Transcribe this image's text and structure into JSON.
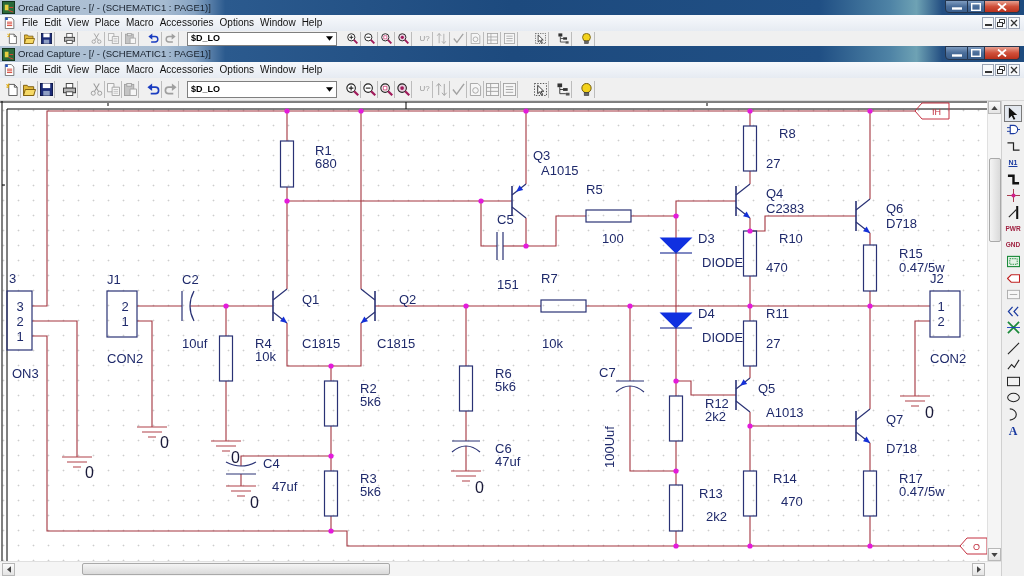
{
  "windows": [
    {
      "title": "Orcad Capture - [/ - (SCHEMATIC1 : PAGE1)]",
      "menu": [
        "File",
        "Edit",
        "View",
        "Place",
        "Macro",
        "Accessories",
        "Options",
        "Window",
        "Help"
      ],
      "toolbar": [
        {
          "kind": "new",
          "disabled": false
        },
        {
          "kind": "open",
          "disabled": false
        },
        {
          "kind": "save",
          "disabled": false
        },
        {
          "kind": "print",
          "disabled": false
        },
        {
          "kind": "cut",
          "disabled": true
        },
        {
          "kind": "copy",
          "disabled": true
        },
        {
          "kind": "paste",
          "disabled": true
        },
        {
          "kind": "undo",
          "disabled": false
        },
        {
          "kind": "redo",
          "disabled": true
        },
        {
          "kind": "part_combo",
          "value": "$D_LO",
          "disabled": false
        },
        {
          "kind": "zoom_in",
          "disabled": false
        },
        {
          "kind": "zoom_out",
          "disabled": false
        },
        {
          "kind": "zoom_area",
          "disabled": false
        },
        {
          "kind": "zoom_all",
          "disabled": false
        },
        {
          "kind": "annotate",
          "glyph": "U?",
          "disabled": true
        },
        {
          "kind": "back_annotate",
          "disabled": true
        },
        {
          "kind": "drc",
          "disabled": true
        },
        {
          "kind": "netlist",
          "disabled": true
        },
        {
          "kind": "cross_ref",
          "disabled": true
        },
        {
          "kind": "bom",
          "disabled": true
        },
        {
          "kind": "area_select",
          "disabled": false
        },
        {
          "kind": "tree",
          "disabled": false
        },
        {
          "kind": "help",
          "disabled": false
        }
      ]
    },
    {
      "title": "Orcad Capture - [/ - (SCHEMATIC1 : PAGE1)]",
      "menu": [
        "File",
        "Edit",
        "View",
        "Place",
        "Macro",
        "Accessories",
        "Options",
        "Window",
        "Help"
      ],
      "toolbar": [
        {
          "kind": "new",
          "disabled": false
        },
        {
          "kind": "open",
          "disabled": false
        },
        {
          "kind": "save",
          "disabled": false
        },
        {
          "kind": "print",
          "disabled": false
        },
        {
          "kind": "cut",
          "disabled": true
        },
        {
          "kind": "copy",
          "disabled": true
        },
        {
          "kind": "paste",
          "disabled": true
        },
        {
          "kind": "undo",
          "disabled": false
        },
        {
          "kind": "redo",
          "disabled": true
        },
        {
          "kind": "part_combo",
          "value": "$D_LO",
          "disabled": false
        },
        {
          "kind": "zoom_in",
          "disabled": false
        },
        {
          "kind": "zoom_out",
          "disabled": false
        },
        {
          "kind": "zoom_area",
          "disabled": false
        },
        {
          "kind": "zoom_all",
          "disabled": false
        },
        {
          "kind": "annotate",
          "glyph": "U?",
          "disabled": true
        },
        {
          "kind": "back_annotate",
          "disabled": true
        },
        {
          "kind": "drc",
          "disabled": true
        },
        {
          "kind": "netlist",
          "disabled": true
        },
        {
          "kind": "cross_ref",
          "disabled": true
        },
        {
          "kind": "bom",
          "disabled": true
        },
        {
          "kind": "area_select",
          "disabled": false
        },
        {
          "kind": "tree",
          "disabled": false
        },
        {
          "kind": "help",
          "disabled": false
        }
      ],
      "palette": [
        {
          "kind": "select",
          "selected": true,
          "disabled": false
        },
        {
          "kind": "part",
          "selected": false,
          "disabled": false
        },
        {
          "kind": "wire",
          "selected": false,
          "disabled": false
        },
        {
          "kind": "net_alias",
          "glyph": "N1",
          "selected": false,
          "disabled": false
        },
        {
          "kind": "bus",
          "selected": false,
          "disabled": false
        },
        {
          "kind": "junction",
          "selected": false,
          "disabled": false
        },
        {
          "kind": "bus_entry",
          "selected": false,
          "disabled": false
        },
        {
          "kind": "power",
          "glyph": "PWR",
          "selected": false,
          "disabled": false
        },
        {
          "kind": "ground",
          "glyph": "GND",
          "selected": false,
          "disabled": false
        },
        {
          "kind": "hier_block",
          "selected": false,
          "disabled": false
        },
        {
          "kind": "hier_port",
          "selected": false,
          "disabled": false
        },
        {
          "kind": "hier_pin",
          "selected": false,
          "disabled": true
        },
        {
          "kind": "off_page",
          "selected": false,
          "disabled": false
        },
        {
          "kind": "no_connect",
          "selected": false,
          "disabled": false
        },
        {
          "kind": "line",
          "selected": false,
          "disabled": false
        },
        {
          "kind": "polyline",
          "selected": false,
          "disabled": false
        },
        {
          "kind": "rectangle",
          "selected": false,
          "disabled": false
        },
        {
          "kind": "ellipse",
          "selected": false,
          "disabled": false
        },
        {
          "kind": "arc",
          "selected": false,
          "disabled": false
        },
        {
          "kind": "text",
          "glyph": "A",
          "selected": false,
          "disabled": false
        }
      ],
      "schematic": {
        "parts": [
          {
            "kind": "connector",
            "ref": "3",
            "value": "ON3",
            "pins": [
              "3",
              "2",
              "1"
            ]
          },
          {
            "kind": "connector",
            "ref": "J1",
            "value": "CON2",
            "pins": [
              "2",
              "1"
            ]
          },
          {
            "kind": "polarized_capacitor",
            "ref": "C2",
            "value": "10uf"
          },
          {
            "kind": "resistor",
            "ref": "R4",
            "value": "10k"
          },
          {
            "kind": "polarized_capacitor",
            "ref": "C4",
            "value": "47uf"
          },
          {
            "kind": "resistor",
            "ref": "R1",
            "value": "680"
          },
          {
            "kind": "npn",
            "ref": "Q1",
            "value": "C1815"
          },
          {
            "kind": "npn",
            "ref": "Q2",
            "value": "C1815"
          },
          {
            "kind": "resistor",
            "ref": "R2",
            "value": "5k6"
          },
          {
            "kind": "resistor",
            "ref": "R3",
            "value": "5k6"
          },
          {
            "kind": "capacitor",
            "ref": "C5",
            "value": "151"
          },
          {
            "kind": "resistor",
            "ref": "R6",
            "value": "5k6"
          },
          {
            "kind": "polarized_capacitor",
            "ref": "C6",
            "value": "47uf"
          },
          {
            "kind": "pnp",
            "ref": "Q3",
            "value": "A1015"
          },
          {
            "kind": "resistor",
            "ref": "R7",
            "value": "10k"
          },
          {
            "kind": "resistor",
            "ref": "R5",
            "value": "100"
          },
          {
            "kind": "polarized_capacitor",
            "ref": "C7",
            "value": "100Uuf"
          },
          {
            "kind": "diode",
            "ref": "D3",
            "value": "DIODE"
          },
          {
            "kind": "diode",
            "ref": "D4",
            "value": "DIODE"
          },
          {
            "kind": "resistor",
            "ref": "R12",
            "value": "2k2"
          },
          {
            "kind": "resistor",
            "ref": "R13",
            "value": "2k2"
          },
          {
            "kind": "resistor",
            "ref": "R8",
            "value": "27"
          },
          {
            "kind": "npn",
            "ref": "Q4",
            "value": "C2383"
          },
          {
            "kind": "resistor",
            "ref": "R10",
            "value": "470"
          },
          {
            "kind": "resistor",
            "ref": "R11",
            "value": "27"
          },
          {
            "kind": "pnp",
            "ref": "Q5",
            "value": "A1013"
          },
          {
            "kind": "resistor",
            "ref": "R14",
            "value": "470"
          },
          {
            "kind": "npn",
            "ref": "Q6",
            "value": "D718"
          },
          {
            "kind": "resistor",
            "ref": "R15",
            "value": "0.47/5w"
          },
          {
            "kind": "connector",
            "ref": "J2",
            "value": "CON2",
            "pins": [
              "1",
              "2"
            ]
          },
          {
            "kind": "npn",
            "ref": "Q7",
            "value": "D718"
          },
          {
            "kind": "resistor",
            "ref": "R17",
            "value": "0.47/5w"
          }
        ],
        "grounds": [
          "0",
          "0",
          "0",
          "0",
          "0",
          "0"
        ],
        "ports": [
          "IH",
          "O"
        ]
      }
    }
  ]
}
